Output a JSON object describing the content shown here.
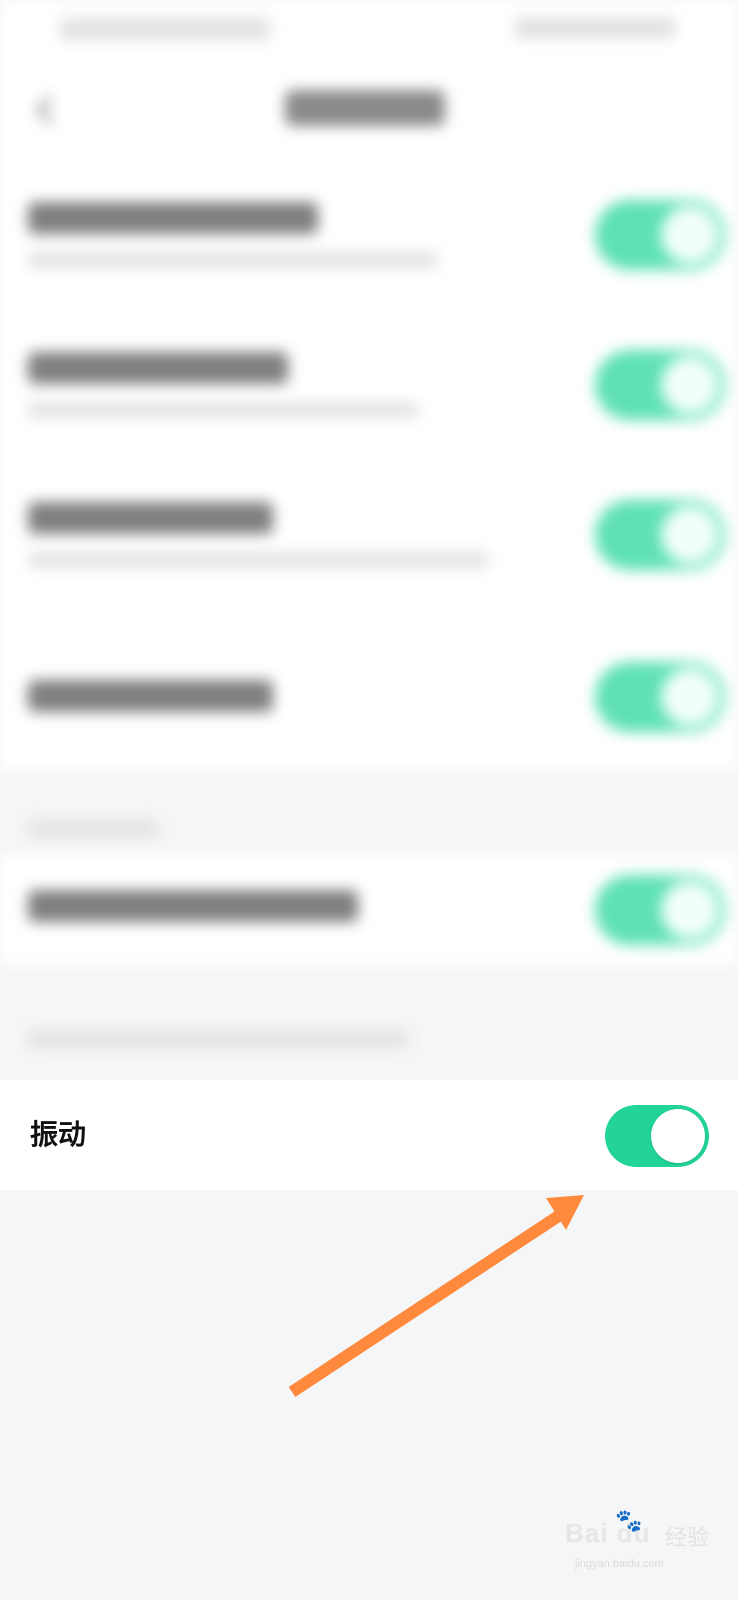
{
  "settings": {
    "vibration_label": "振动",
    "vibration_enabled": true
  },
  "colors": {
    "switch_on": "#22d597",
    "annotation_arrow": "#ff8a3d",
    "background": "#f5f6f8"
  },
  "watermark": {
    "logo": "Bai du",
    "paw": "🐾",
    "jingyan": "经验",
    "url": "jingyan.baidu.com"
  }
}
